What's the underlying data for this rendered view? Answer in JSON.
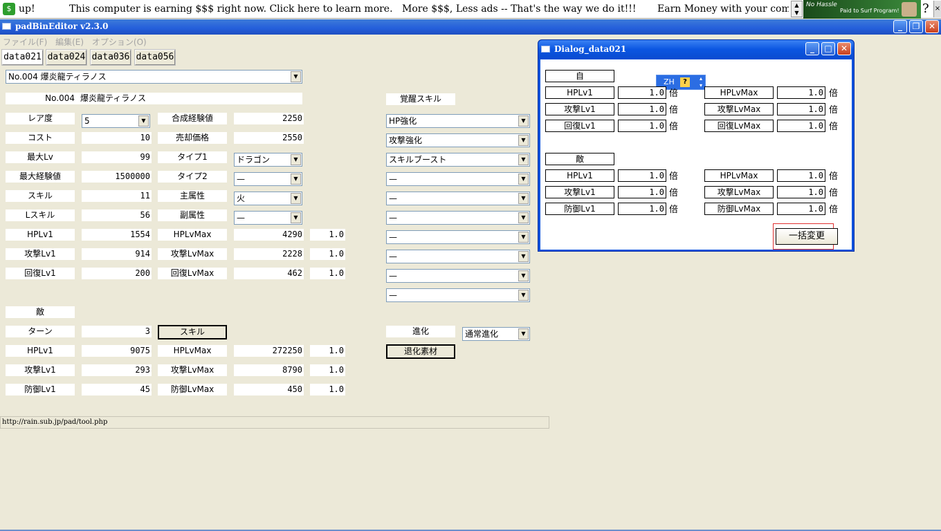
{
  "ad_bar": {
    "items": [
      "up!",
      "This computer is earning $$$ right now. Click here to learn more.",
      "More $$$, Less ads -- That's the way we do it!!!",
      "Earn Money with your compu"
    ],
    "banner_line1": "No Hassle",
    "banner_line2": "Paid to Surf Program!",
    "help": "?"
  },
  "window": {
    "title": "padBinEditor v2.3.0",
    "menu": [
      "ファイル(F)",
      "編集(E)",
      "オプション(O)"
    ],
    "tabs": [
      "data021",
      "data024",
      "data036",
      "data056"
    ],
    "monster_select": "No.004 爆炎龍ティラノス",
    "no_label": "No.004",
    "name": "爆炎龍ティラノス"
  },
  "stats": {
    "rarity": {
      "label": "レア度",
      "value": "5"
    },
    "cost": {
      "label": "コスト",
      "value": "10"
    },
    "max_lv": {
      "label": "最大Lv",
      "value": "99"
    },
    "max_exp": {
      "label": "最大経験値",
      "value": "1500000"
    },
    "skill": {
      "label": "スキル",
      "value": "11"
    },
    "l_skill": {
      "label": "Lスキル",
      "value": "56"
    },
    "fusion_exp": {
      "label": "合成経験値",
      "value": "2250"
    },
    "sell_price": {
      "label": "売却価格",
      "value": "2550"
    },
    "type1": {
      "label": "タイプ1",
      "value": "ドラゴン"
    },
    "type2": {
      "label": "タイプ2",
      "value": "—"
    },
    "main_attr": {
      "label": "主属性",
      "value": "火"
    },
    "sub_attr": {
      "label": "副属性",
      "value": "—"
    }
  },
  "self_rows": [
    {
      "l1": "HPLv1",
      "v1": "1554",
      "l2": "HPLvMax",
      "v2": "4290",
      "m": "1.0"
    },
    {
      "l1": "攻撃Lv1",
      "v1": "914",
      "l2": "攻撃LvMax",
      "v2": "2228",
      "m": "1.0"
    },
    {
      "l1": "回復Lv1",
      "v1": "200",
      "l2": "回復LvMax",
      "v2": "462",
      "m": "1.0"
    }
  ],
  "enemy": {
    "title": "敵",
    "turn_label": "ターン",
    "turn_value": "3",
    "skill_button": "スキル",
    "rows": [
      {
        "l1": "HPLv1",
        "v1": "9075",
        "l2": "HPLvMax",
        "v2": "272250",
        "m": "1.0"
      },
      {
        "l1": "攻撃Lv1",
        "v1": "293",
        "l2": "攻撃LvMax",
        "v2": "8790",
        "m": "1.0"
      },
      {
        "l1": "防御Lv1",
        "v1": "45",
        "l2": "防御LvMax",
        "v2": "450",
        "m": "1.0"
      }
    ]
  },
  "awaken": {
    "title": "覚醒スキル",
    "skills": [
      "HP強化",
      "攻撃強化",
      "スキルブースト",
      "—",
      "—",
      "—",
      "—",
      "—",
      "—"
    ]
  },
  "evolution": {
    "label": "進化",
    "type": "通常進化",
    "button": "退化素材"
  },
  "status_url": "http://rain.sub.jp/pad/tool.php",
  "dialog": {
    "title": "Dialog_data021",
    "ime": "ZH",
    "ime_help": "?",
    "self_title": "自",
    "self_rows": [
      {
        "l1": "HPLv1",
        "v1": "1.0",
        "l2": "HPLvMax",
        "v2": "1.0"
      },
      {
        "l1": "攻撃Lv1",
        "v1": "1.0",
        "l2": "攻撃LvMax",
        "v2": "1.0"
      },
      {
        "l1": "回復Lv1",
        "v1": "1.0",
        "l2": "回復LvMax",
        "v2": "1.0"
      }
    ],
    "enemy_title": "敵",
    "enemy_rows": [
      {
        "l1": "HPLv1",
        "v1": "1.0",
        "l2": "HPLvMax",
        "v2": "1.0"
      },
      {
        "l1": "攻撃Lv1",
        "v1": "1.0",
        "l2": "攻撃LvMax",
        "v2": "1.0"
      },
      {
        "l1": "防御Lv1",
        "v1": "1.0",
        "l2": "防御LvMax",
        "v2": "1.0"
      }
    ],
    "unit": "倍",
    "bulk_button": "一括変更"
  }
}
